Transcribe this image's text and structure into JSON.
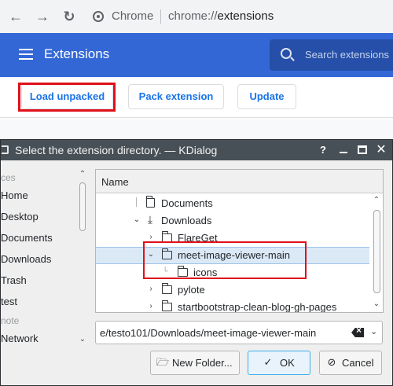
{
  "browser": {
    "omnibox_site": "Chrome",
    "url_scheme": "chrome://",
    "url_path": "extensions"
  },
  "extensions": {
    "title": "Extensions",
    "search_placeholder": "Search extensions",
    "buttons": {
      "load_unpacked": "Load unpacked",
      "pack_extension": "Pack extension",
      "update": "Update"
    }
  },
  "dialog": {
    "title": "Select the extension directory. — KDialog",
    "controls": {
      "help": "?"
    },
    "places": {
      "sections": [
        "ces",
        "note"
      ],
      "items": [
        "Home",
        "Desktop",
        "Documents",
        "Downloads",
        "Trash",
        "test",
        "Network"
      ]
    },
    "tree": {
      "column_header": "Name",
      "rows": [
        {
          "label": "Documents",
          "depth": 2,
          "expander": "none",
          "icon": "documents-folder-icon",
          "selected": false
        },
        {
          "label": "Downloads",
          "depth": 2,
          "expander": "expanded",
          "icon": "downloads-folder-icon",
          "selected": false
        },
        {
          "label": "FlareGet",
          "depth": 3,
          "expander": "collapsed",
          "icon": "folder-icon",
          "selected": false
        },
        {
          "label": "meet-image-viewer-main",
          "depth": 3,
          "expander": "expanded",
          "icon": "folder-icon",
          "selected": true
        },
        {
          "label": "icons",
          "depth": 4,
          "expander": "none",
          "icon": "folder-icon",
          "selected": false
        },
        {
          "label": "pylote",
          "depth": 3,
          "expander": "collapsed",
          "icon": "folder-icon",
          "selected": false
        },
        {
          "label": "startbootstrap-clean-blog-gh-pages",
          "depth": 3,
          "expander": "collapsed",
          "icon": "folder-icon",
          "selected": false
        }
      ]
    },
    "path_value": "e/testo101/Downloads/meet-image-viewer-main",
    "buttons": {
      "new_folder": "New Folder...",
      "ok": "OK",
      "cancel": "Cancel"
    }
  },
  "colors": {
    "accent_blue": "#3367d6",
    "button_text": "#1a73e8",
    "highlight_red": "#e0101b",
    "dialog_titlebar": "#475057",
    "selection": "#dbe9f7"
  }
}
